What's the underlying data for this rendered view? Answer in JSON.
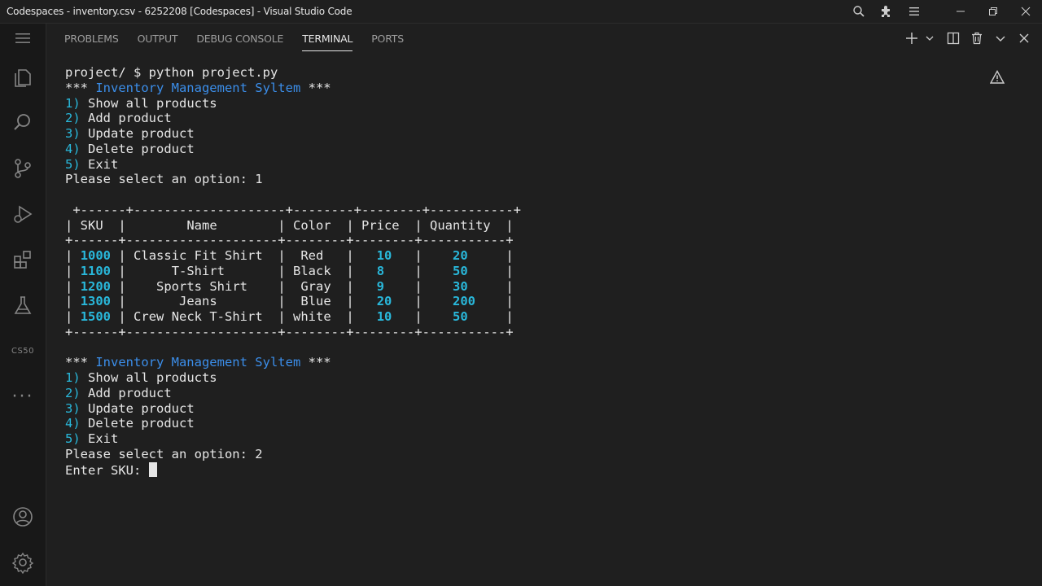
{
  "window": {
    "title": "Codespaces - inventory.csv - 6252208 [Codespaces] - Visual Studio Code"
  },
  "panel": {
    "tabs": [
      "PROBLEMS",
      "OUTPUT",
      "DEBUG CONSOLE",
      "TERMINAL",
      "PORTS"
    ],
    "active_tab": "TERMINAL"
  },
  "activity_bar": {
    "cs50_label": "CS50",
    "more_label": "···"
  },
  "terminal": {
    "command_line": "project/ $ python project.py",
    "menu_title_prefix": "*** ",
    "menu_title": "Inventory Management Syltem",
    "menu_title_suffix": " ***",
    "menu_items": [
      {
        "num": "1)",
        "label": " Show all products"
      },
      {
        "num": "2)",
        "label": " Add product"
      },
      {
        "num": "3)",
        "label": " Update product"
      },
      {
        "num": "4)",
        "label": " Delete product"
      },
      {
        "num": "5)",
        "label": " Exit"
      }
    ],
    "prompt_first": "Please select an option: 1",
    "table_top": " +------+--------------------+--------+--------+-----------+",
    "table_header": "| SKU  |        Name        | Color  | Price  | Quantity  |",
    "table_sep": "+------+--------------------+--------+--------+-----------+",
    "table_columns": [
      "SKU",
      "Name",
      "Color",
      "Price",
      "Quantity"
    ],
    "table_rows": [
      {
        "sku": "1000",
        "name": "Classic Fit Shirt",
        "color": "Red",
        "price": "10",
        "qty": "20"
      },
      {
        "sku": "1100",
        "name": "T-Shirt",
        "color": "Black",
        "price": "8",
        "qty": "50"
      },
      {
        "sku": "1200",
        "name": "Sports Shirt",
        "color": "Gray",
        "price": "9",
        "qty": "30"
      },
      {
        "sku": "1300",
        "name": "Jeans",
        "color": "Blue",
        "price": "20",
        "qty": "200"
      },
      {
        "sku": "1500",
        "name": "Crew Neck T-Shirt",
        "color": "white",
        "price": "10",
        "qty": "50"
      }
    ],
    "table_bottom": "+------+--------------------+--------+--------+-----------+",
    "prompt_second": "Please select an option: 2",
    "sku_prompt": "Enter SKU: "
  },
  "colors": {
    "background": "#1f1f1f",
    "title_blue": "#3b8eea",
    "number_cyan": "#29b8db"
  },
  "icons": {
    "titlebar": [
      "search-icon",
      "extensions-icon",
      "menu-icon"
    ],
    "window_controls": [
      "minimize-icon",
      "restore-icon",
      "close-icon"
    ],
    "activity_bar": [
      "menu-icon",
      "explorer-icon",
      "search-icon",
      "source-control-icon",
      "run-debug-icon",
      "extensions-icon",
      "testing-icon",
      "accounts-icon",
      "settings-gear-icon"
    ],
    "panel_actions": [
      "new-terminal-icon",
      "chevron-down-icon",
      "split-terminal-icon",
      "trash-icon",
      "chevron-down-icon",
      "close-icon"
    ]
  }
}
